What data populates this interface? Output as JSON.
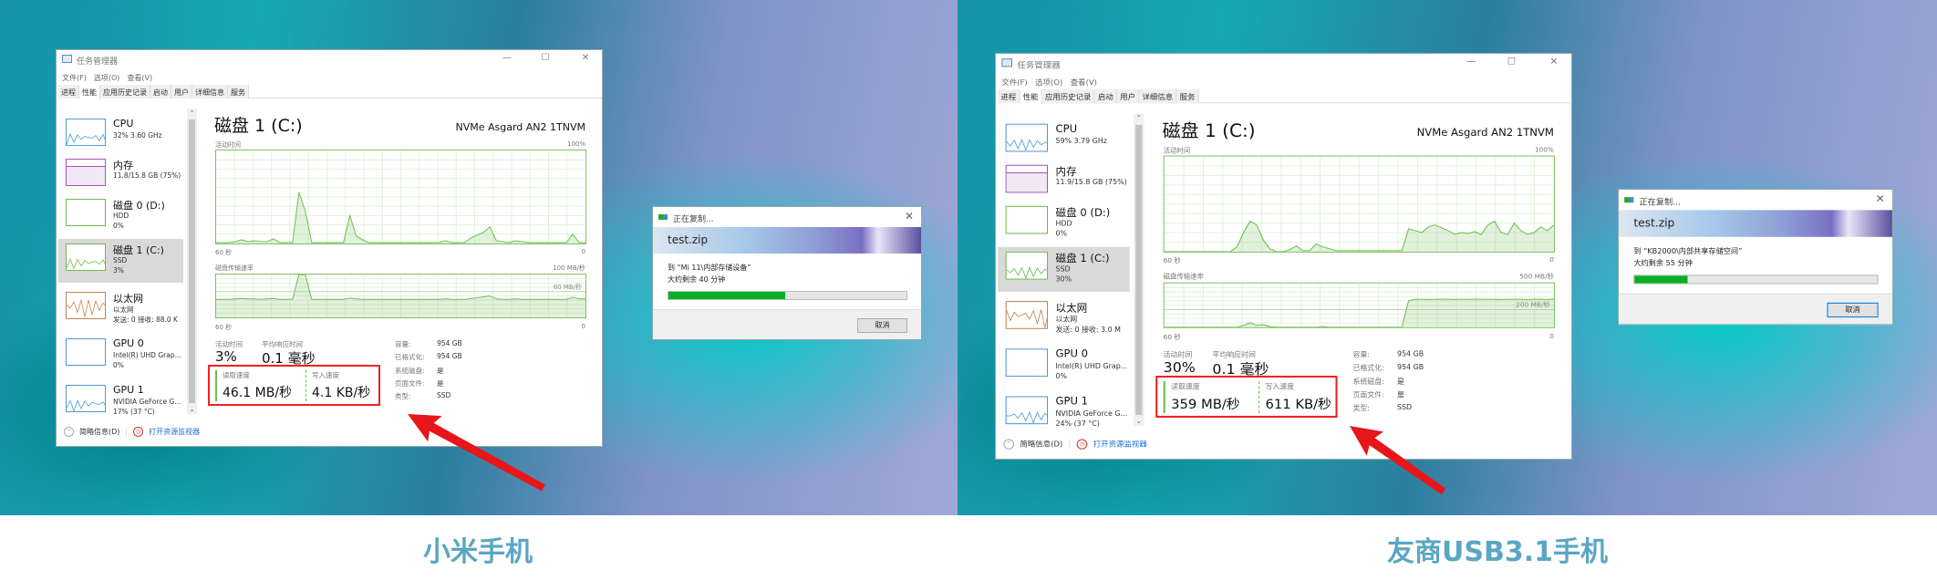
{
  "panels": [
    {
      "caption": "小米手机",
      "task_manager": {
        "title": "任务管理器",
        "menu": [
          "文件(F)",
          "选项(O)",
          "查看(V)"
        ],
        "tabs": [
          "进程",
          "性能",
          "应用历史记录",
          "启动",
          "用户",
          "详细信息",
          "服务"
        ],
        "active_tab": 1,
        "sidebar": [
          {
            "name": "CPU",
            "line1": "32%  3.60 GHz",
            "line2": "",
            "color": "#4a9bd6"
          },
          {
            "name": "内存",
            "line1": "11.8/15.8 GB (75%)",
            "line2": "",
            "color": "#a64dc7"
          },
          {
            "name": "磁盘 0 (D:)",
            "line1": "HDD",
            "line2": "0%",
            "color": "#6bbd4a"
          },
          {
            "name": "磁盘 1 (C:)",
            "line1": "SSD",
            "line2": "3%",
            "color": "#6bbd4a"
          },
          {
            "name": "以太网",
            "line1": "以太网",
            "line2": "发送: 0 接收: 88.0 K",
            "color": "#c8824a"
          },
          {
            "name": "GPU 0",
            "line1": "Intel(R) UHD Grap...",
            "line2": "0%",
            "color": "#4a9bd6"
          },
          {
            "name": "GPU 1",
            "line1": "NVIDIA GeForce G...",
            "line2": "17% (37 °C)",
            "color": "#4a9bd6"
          }
        ],
        "selected_item": 3,
        "disk_title": "磁盘 1 (C:)",
        "model": "NVMe Asgard AN2 1TNVM",
        "chart1": {
          "label": "活动时间",
          "max_label": "100%",
          "x_left": "60 秒",
          "x_right": "0",
          "max_value": 100,
          "values": [
            1,
            1,
            1,
            2,
            4,
            2,
            3,
            2,
            2,
            5,
            1,
            1,
            1,
            55,
            35,
            1,
            1,
            1,
            1,
            1,
            1,
            30,
            8,
            4,
            1,
            1,
            1,
            1,
            1,
            1,
            1,
            1,
            1,
            1,
            1,
            1,
            3,
            1,
            1,
            1,
            6,
            9,
            12,
            18,
            3,
            2,
            1,
            3,
            2,
            1,
            1,
            1,
            1,
            1,
            1,
            1,
            10,
            1,
            1
          ]
        },
        "chart2": {
          "label": "磁盘传输速率",
          "max_label": "100 MB/秒",
          "ref_label": "60 MB/秒",
          "x_left": "60 秒",
          "x_right": "0",
          "max_value": 100,
          "ref_value": 60,
          "values": [
            42,
            42,
            42,
            43,
            44,
            43,
            43,
            42,
            43,
            44,
            42,
            42,
            42,
            100,
            100,
            42,
            42,
            42,
            42,
            42,
            42,
            45,
            43,
            42,
            42,
            42,
            42,
            42,
            42,
            42,
            42,
            42,
            42,
            42,
            42,
            42,
            43,
            42,
            42,
            42,
            44,
            46,
            48,
            50,
            43,
            42,
            42,
            43,
            42,
            42,
            42,
            42,
            42,
            42,
            42,
            42,
            47,
            43,
            43
          ]
        },
        "stats": {
          "active_label": "活动时间",
          "active": "3%",
          "resp_label": "平均响应时间",
          "resp": "0.1 毫秒",
          "read_label": "读取速度",
          "read": "46.1 MB/秒",
          "write_label": "写入速度",
          "write": "4.1 KB/秒"
        },
        "props": [
          [
            "容量:",
            "954 GB"
          ],
          [
            "已格式化:",
            "954 GB"
          ],
          [
            "系统磁盘:",
            "是"
          ],
          [
            "页面文件:",
            "是"
          ],
          [
            "类型:",
            "SSD"
          ]
        ],
        "footer": {
          "fewer": "简略信息(D)",
          "monitor": "打开资源监视器"
        }
      },
      "copy_dialog": {
        "title": "正在复制...",
        "file": "test.zip",
        "dest": "到 “Mi 11\\内部存储设备”",
        "remaining": "大约剩余 40 分钟",
        "progress": 0.49,
        "cancel": "取消",
        "bar_color": "#06b025"
      }
    },
    {
      "caption": "友商USB3.1手机",
      "task_manager": {
        "title": "任务管理器",
        "menu": [
          "文件(F)",
          "选项(O)",
          "查看(V)"
        ],
        "tabs": [
          "进程",
          "性能",
          "应用历史记录",
          "启动",
          "用户",
          "详细信息",
          "服务"
        ],
        "active_tab": 1,
        "sidebar": [
          {
            "name": "CPU",
            "line1": "59%  3.79 GHz",
            "line2": "",
            "color": "#4a9bd6"
          },
          {
            "name": "内存",
            "line1": "11.9/15.8 GB (75%)",
            "line2": "",
            "color": "#a64dc7"
          },
          {
            "name": "磁盘 0 (D:)",
            "line1": "HDD",
            "line2": "0%",
            "color": "#6bbd4a"
          },
          {
            "name": "磁盘 1 (C:)",
            "line1": "SSD",
            "line2": "30%",
            "color": "#6bbd4a"
          },
          {
            "name": "以太网",
            "line1": "以太网",
            "line2": "发送: 0 接收: 3.0 M",
            "color": "#c8824a"
          },
          {
            "name": "GPU 0",
            "line1": "Intel(R) UHD Grap...",
            "line2": "0%",
            "color": "#4a9bd6"
          },
          {
            "name": "GPU 1",
            "line1": "NVIDIA GeForce G...",
            "line2": "24% (37 °C)",
            "color": "#4a9bd6"
          }
        ],
        "selected_item": 3,
        "disk_title": "磁盘 1 (C:)",
        "model": "NVMe Asgard AN2 1TNVM",
        "chart1": {
          "label": "活动时间",
          "max_label": "100%",
          "x_left": "60 秒",
          "x_right": "0",
          "max_value": 100,
          "values": [
            0,
            0,
            0,
            0,
            0,
            0,
            0,
            0,
            0,
            0,
            0,
            5,
            20,
            32,
            28,
            12,
            3,
            0,
            0,
            2,
            6,
            1,
            1,
            8,
            5,
            3,
            1,
            1,
            1,
            1,
            1,
            1,
            1,
            1,
            1,
            1,
            1,
            24,
            22,
            20,
            26,
            28,
            25,
            22,
            18,
            20,
            19,
            21,
            18,
            28,
            32,
            20,
            18,
            30,
            22,
            18,
            20,
            26,
            22,
            28
          ]
        },
        "chart2": {
          "label": "磁盘传输速率",
          "max_label": "500 MB/秒",
          "ref_label": "200 MB/秒",
          "x_left": "60 秒",
          "x_right": "0",
          "max_value": 500,
          "ref_value": 200,
          "values": [
            0,
            0,
            0,
            0,
            0,
            0,
            0,
            0,
            0,
            0,
            0,
            0,
            20,
            50,
            20,
            30,
            5,
            0,
            0,
            0,
            0,
            0,
            0,
            0,
            8,
            0,
            0,
            0,
            0,
            0,
            0,
            0,
            0,
            0,
            0,
            0,
            0,
            300,
            318,
            318,
            316,
            318,
            320,
            318,
            316,
            318,
            318,
            320,
            318,
            318,
            318,
            316,
            318,
            318,
            318,
            316,
            318,
            318,
            316,
            322
          ]
        },
        "stats": {
          "active_label": "活动时间",
          "active": "30%",
          "resp_label": "平均响应时间",
          "resp": "0.1 毫秒",
          "read_label": "读取速度",
          "read": "359 MB/秒",
          "write_label": "写入速度",
          "write": "611 KB/秒"
        },
        "props": [
          [
            "容量:",
            "954 GB"
          ],
          [
            "已格式化:",
            "954 GB"
          ],
          [
            "系统磁盘:",
            "是"
          ],
          [
            "页面文件:",
            "是"
          ],
          [
            "类型:",
            "SSD"
          ]
        ],
        "footer": {
          "fewer": "简略信息(D)",
          "monitor": "打开资源监视器"
        }
      },
      "copy_dialog": {
        "title": "正在复制...",
        "file": "test.zip",
        "dest": "到 “KB2000\\内部共享存储空间”",
        "remaining": "大约剩余 55 分钟",
        "progress": 0.22,
        "cancel": "取消",
        "bar_color": "#06b025"
      }
    }
  ]
}
